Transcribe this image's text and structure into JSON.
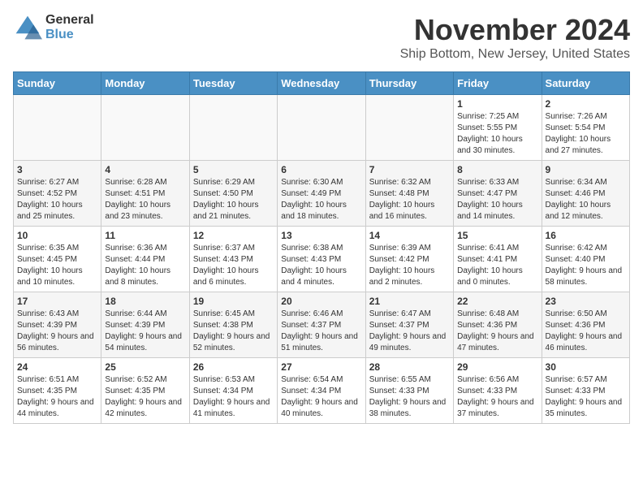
{
  "logo": {
    "general": "General",
    "blue": "Blue"
  },
  "title": "November 2024",
  "subtitle": "Ship Bottom, New Jersey, United States",
  "days_of_week": [
    "Sunday",
    "Monday",
    "Tuesday",
    "Wednesday",
    "Thursday",
    "Friday",
    "Saturday"
  ],
  "weeks": [
    [
      {
        "day": "",
        "empty": true
      },
      {
        "day": "",
        "empty": true
      },
      {
        "day": "",
        "empty": true
      },
      {
        "day": "",
        "empty": true
      },
      {
        "day": "",
        "empty": true
      },
      {
        "day": "1",
        "sunrise": "Sunrise: 7:25 AM",
        "sunset": "Sunset: 5:55 PM",
        "daylight": "Daylight: 10 hours and 30 minutes."
      },
      {
        "day": "2",
        "sunrise": "Sunrise: 7:26 AM",
        "sunset": "Sunset: 5:54 PM",
        "daylight": "Daylight: 10 hours and 27 minutes."
      }
    ],
    [
      {
        "day": "3",
        "sunrise": "Sunrise: 6:27 AM",
        "sunset": "Sunset: 4:52 PM",
        "daylight": "Daylight: 10 hours and 25 minutes."
      },
      {
        "day": "4",
        "sunrise": "Sunrise: 6:28 AM",
        "sunset": "Sunset: 4:51 PM",
        "daylight": "Daylight: 10 hours and 23 minutes."
      },
      {
        "day": "5",
        "sunrise": "Sunrise: 6:29 AM",
        "sunset": "Sunset: 4:50 PM",
        "daylight": "Daylight: 10 hours and 21 minutes."
      },
      {
        "day": "6",
        "sunrise": "Sunrise: 6:30 AM",
        "sunset": "Sunset: 4:49 PM",
        "daylight": "Daylight: 10 hours and 18 minutes."
      },
      {
        "day": "7",
        "sunrise": "Sunrise: 6:32 AM",
        "sunset": "Sunset: 4:48 PM",
        "daylight": "Daylight: 10 hours and 16 minutes."
      },
      {
        "day": "8",
        "sunrise": "Sunrise: 6:33 AM",
        "sunset": "Sunset: 4:47 PM",
        "daylight": "Daylight: 10 hours and 14 minutes."
      },
      {
        "day": "9",
        "sunrise": "Sunrise: 6:34 AM",
        "sunset": "Sunset: 4:46 PM",
        "daylight": "Daylight: 10 hours and 12 minutes."
      }
    ],
    [
      {
        "day": "10",
        "sunrise": "Sunrise: 6:35 AM",
        "sunset": "Sunset: 4:45 PM",
        "daylight": "Daylight: 10 hours and 10 minutes."
      },
      {
        "day": "11",
        "sunrise": "Sunrise: 6:36 AM",
        "sunset": "Sunset: 4:44 PM",
        "daylight": "Daylight: 10 hours and 8 minutes."
      },
      {
        "day": "12",
        "sunrise": "Sunrise: 6:37 AM",
        "sunset": "Sunset: 4:43 PM",
        "daylight": "Daylight: 10 hours and 6 minutes."
      },
      {
        "day": "13",
        "sunrise": "Sunrise: 6:38 AM",
        "sunset": "Sunset: 4:43 PM",
        "daylight": "Daylight: 10 hours and 4 minutes."
      },
      {
        "day": "14",
        "sunrise": "Sunrise: 6:39 AM",
        "sunset": "Sunset: 4:42 PM",
        "daylight": "Daylight: 10 hours and 2 minutes."
      },
      {
        "day": "15",
        "sunrise": "Sunrise: 6:41 AM",
        "sunset": "Sunset: 4:41 PM",
        "daylight": "Daylight: 10 hours and 0 minutes."
      },
      {
        "day": "16",
        "sunrise": "Sunrise: 6:42 AM",
        "sunset": "Sunset: 4:40 PM",
        "daylight": "Daylight: 9 hours and 58 minutes."
      }
    ],
    [
      {
        "day": "17",
        "sunrise": "Sunrise: 6:43 AM",
        "sunset": "Sunset: 4:39 PM",
        "daylight": "Daylight: 9 hours and 56 minutes."
      },
      {
        "day": "18",
        "sunrise": "Sunrise: 6:44 AM",
        "sunset": "Sunset: 4:39 PM",
        "daylight": "Daylight: 9 hours and 54 minutes."
      },
      {
        "day": "19",
        "sunrise": "Sunrise: 6:45 AM",
        "sunset": "Sunset: 4:38 PM",
        "daylight": "Daylight: 9 hours and 52 minutes."
      },
      {
        "day": "20",
        "sunrise": "Sunrise: 6:46 AM",
        "sunset": "Sunset: 4:37 PM",
        "daylight": "Daylight: 9 hours and 51 minutes."
      },
      {
        "day": "21",
        "sunrise": "Sunrise: 6:47 AM",
        "sunset": "Sunset: 4:37 PM",
        "daylight": "Daylight: 9 hours and 49 minutes."
      },
      {
        "day": "22",
        "sunrise": "Sunrise: 6:48 AM",
        "sunset": "Sunset: 4:36 PM",
        "daylight": "Daylight: 9 hours and 47 minutes."
      },
      {
        "day": "23",
        "sunrise": "Sunrise: 6:50 AM",
        "sunset": "Sunset: 4:36 PM",
        "daylight": "Daylight: 9 hours and 46 minutes."
      }
    ],
    [
      {
        "day": "24",
        "sunrise": "Sunrise: 6:51 AM",
        "sunset": "Sunset: 4:35 PM",
        "daylight": "Daylight: 9 hours and 44 minutes."
      },
      {
        "day": "25",
        "sunrise": "Sunrise: 6:52 AM",
        "sunset": "Sunset: 4:35 PM",
        "daylight": "Daylight: 9 hours and 42 minutes."
      },
      {
        "day": "26",
        "sunrise": "Sunrise: 6:53 AM",
        "sunset": "Sunset: 4:34 PM",
        "daylight": "Daylight: 9 hours and 41 minutes."
      },
      {
        "day": "27",
        "sunrise": "Sunrise: 6:54 AM",
        "sunset": "Sunset: 4:34 PM",
        "daylight": "Daylight: 9 hours and 40 minutes."
      },
      {
        "day": "28",
        "sunrise": "Sunrise: 6:55 AM",
        "sunset": "Sunset: 4:33 PM",
        "daylight": "Daylight: 9 hours and 38 minutes."
      },
      {
        "day": "29",
        "sunrise": "Sunrise: 6:56 AM",
        "sunset": "Sunset: 4:33 PM",
        "daylight": "Daylight: 9 hours and 37 minutes."
      },
      {
        "day": "30",
        "sunrise": "Sunrise: 6:57 AM",
        "sunset": "Sunset: 4:33 PM",
        "daylight": "Daylight: 9 hours and 35 minutes."
      }
    ]
  ]
}
